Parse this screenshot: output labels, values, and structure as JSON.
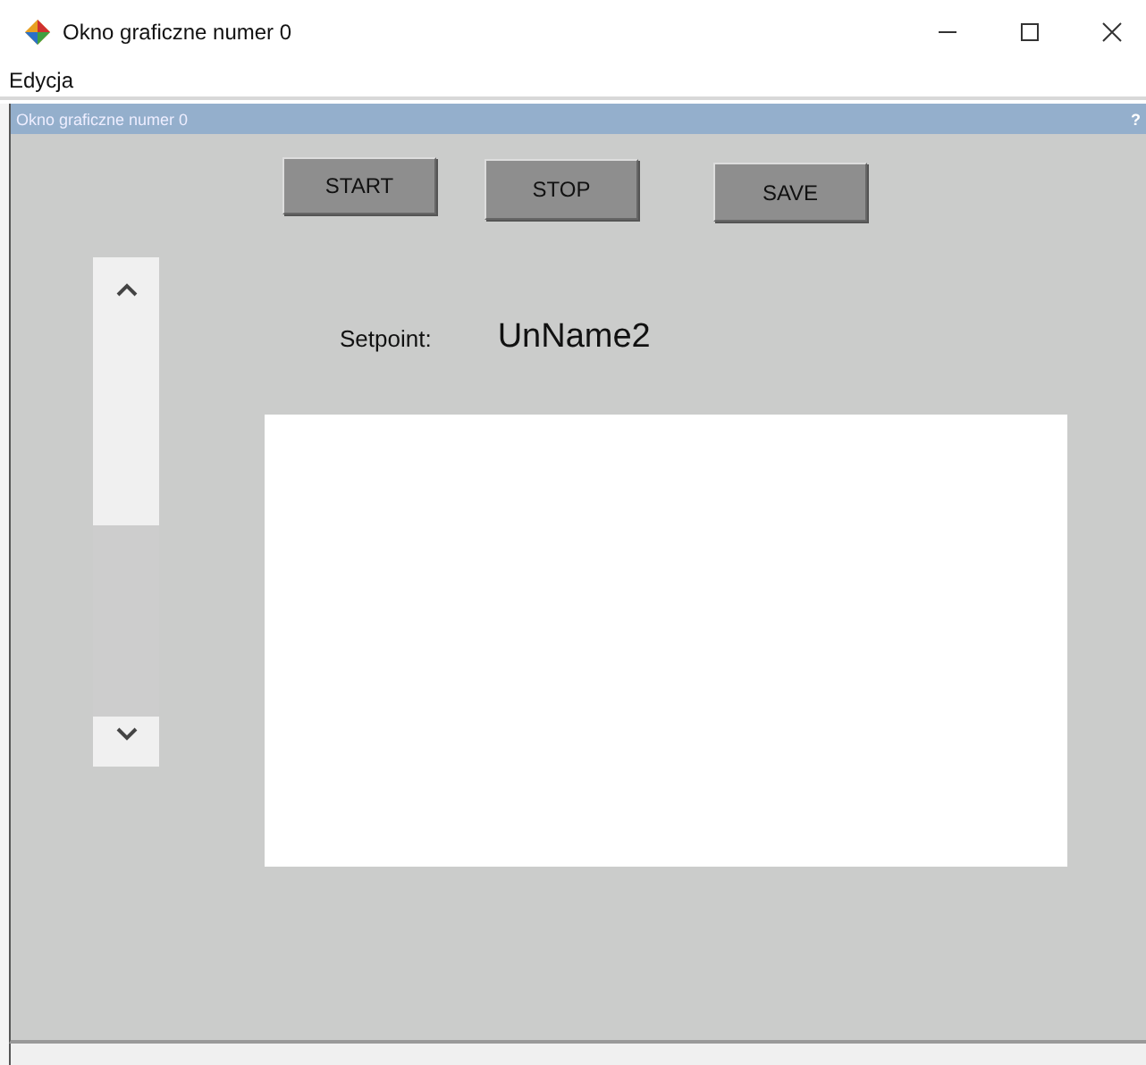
{
  "window": {
    "title": "Okno graficzne numer 0"
  },
  "menu": [
    "Edycja"
  ],
  "panel": {
    "title": "Okno graficzne numer 0",
    "help": "?"
  },
  "buttons": [
    "START",
    "STOP",
    "SAVE"
  ],
  "setpoint": {
    "label": "Setpoint:",
    "value": "UnName2"
  }
}
